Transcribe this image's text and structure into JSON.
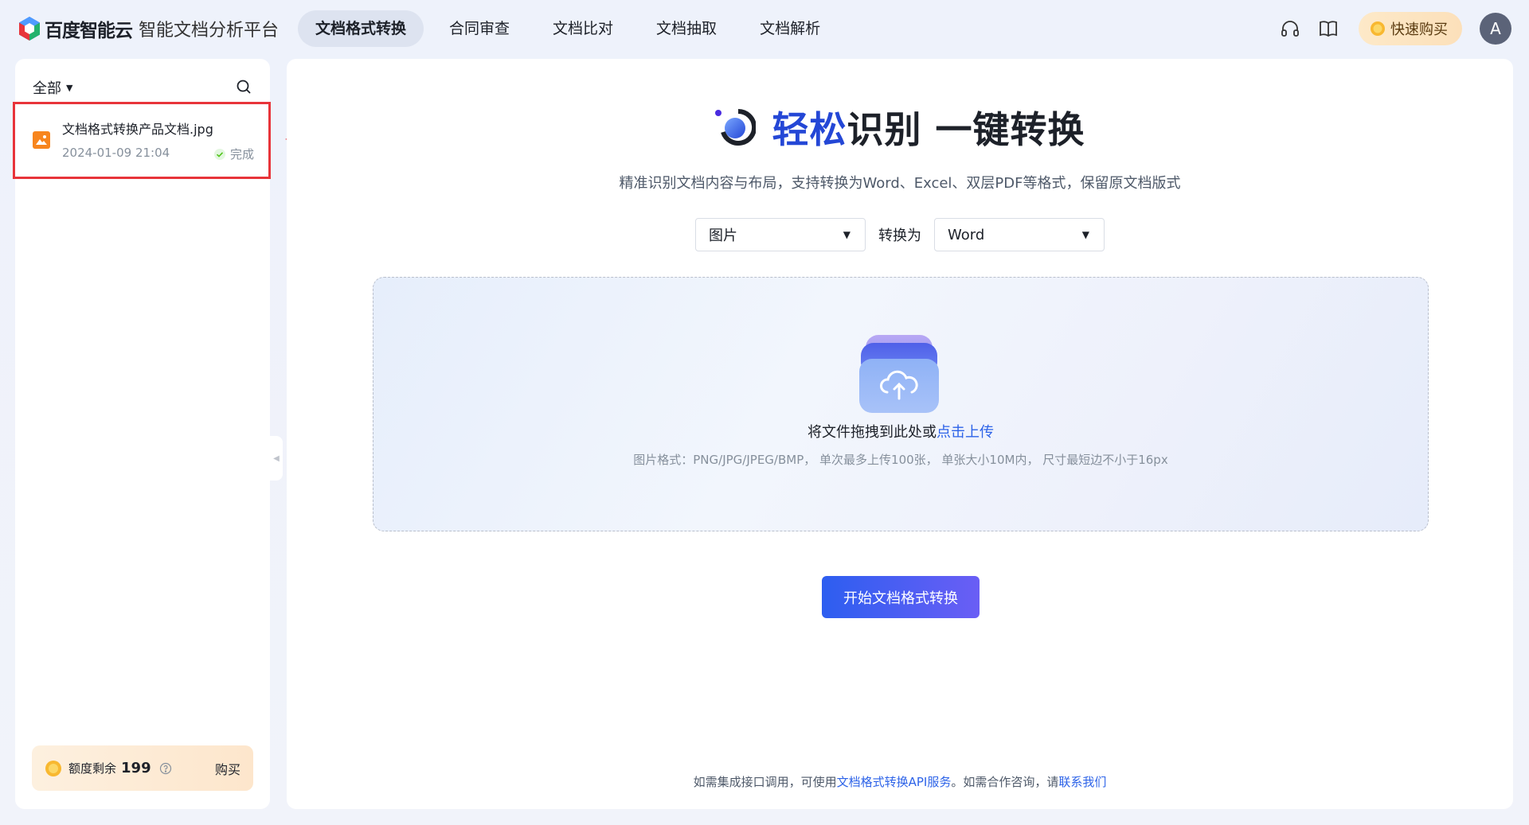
{
  "brand": {
    "name": "百度智能云",
    "subtitle": "智能文档分析平台"
  },
  "nav": {
    "items": [
      {
        "label": "文档格式转换",
        "active": true
      },
      {
        "label": "合同审查",
        "active": false
      },
      {
        "label": "文档比对",
        "active": false
      },
      {
        "label": "文档抽取",
        "active": false
      },
      {
        "label": "文档解析",
        "active": false
      }
    ]
  },
  "top_right": {
    "icons": [
      "headset-icon",
      "book-icon"
    ],
    "buy_label": "快速购买",
    "avatar_initial": "A"
  },
  "sidebar": {
    "filter_label": "全部",
    "files": [
      {
        "name": "文档格式转换产品文档.jpg",
        "date": "2024-01-09 21:04",
        "status": "完成"
      }
    ],
    "quota": {
      "label": "额度剩余",
      "value": "199",
      "buy_label": "购买"
    }
  },
  "main": {
    "title_highlight": "轻松",
    "title_rest": "识别 一键转换",
    "subtitle": "精准识别文档内容与布局，支持转换为Word、Excel、双层PDF等格式，保留原文档版式",
    "source_format": "图片",
    "convert_label": "转换为",
    "target_format": "Word",
    "upload": {
      "text_prefix": "将文件拖拽到此处或",
      "link": "点击上传",
      "note": "图片格式：PNG/JPG/JPEG/BMP， 单次最多上传100张， 单张大小10M内， 尺寸最短边不小于16px"
    },
    "start_button": "开始文档格式转换",
    "footer": {
      "part1": "如需集成接口调用，可使用",
      "link1": "文档格式转换API服务",
      "part2": "。如需合作咨询，请",
      "link2": "联系我们"
    }
  },
  "colors": {
    "accent": "#2447d6",
    "link": "#2d63e8",
    "highlight_border": "#e8343a",
    "success": "#52c41a"
  }
}
